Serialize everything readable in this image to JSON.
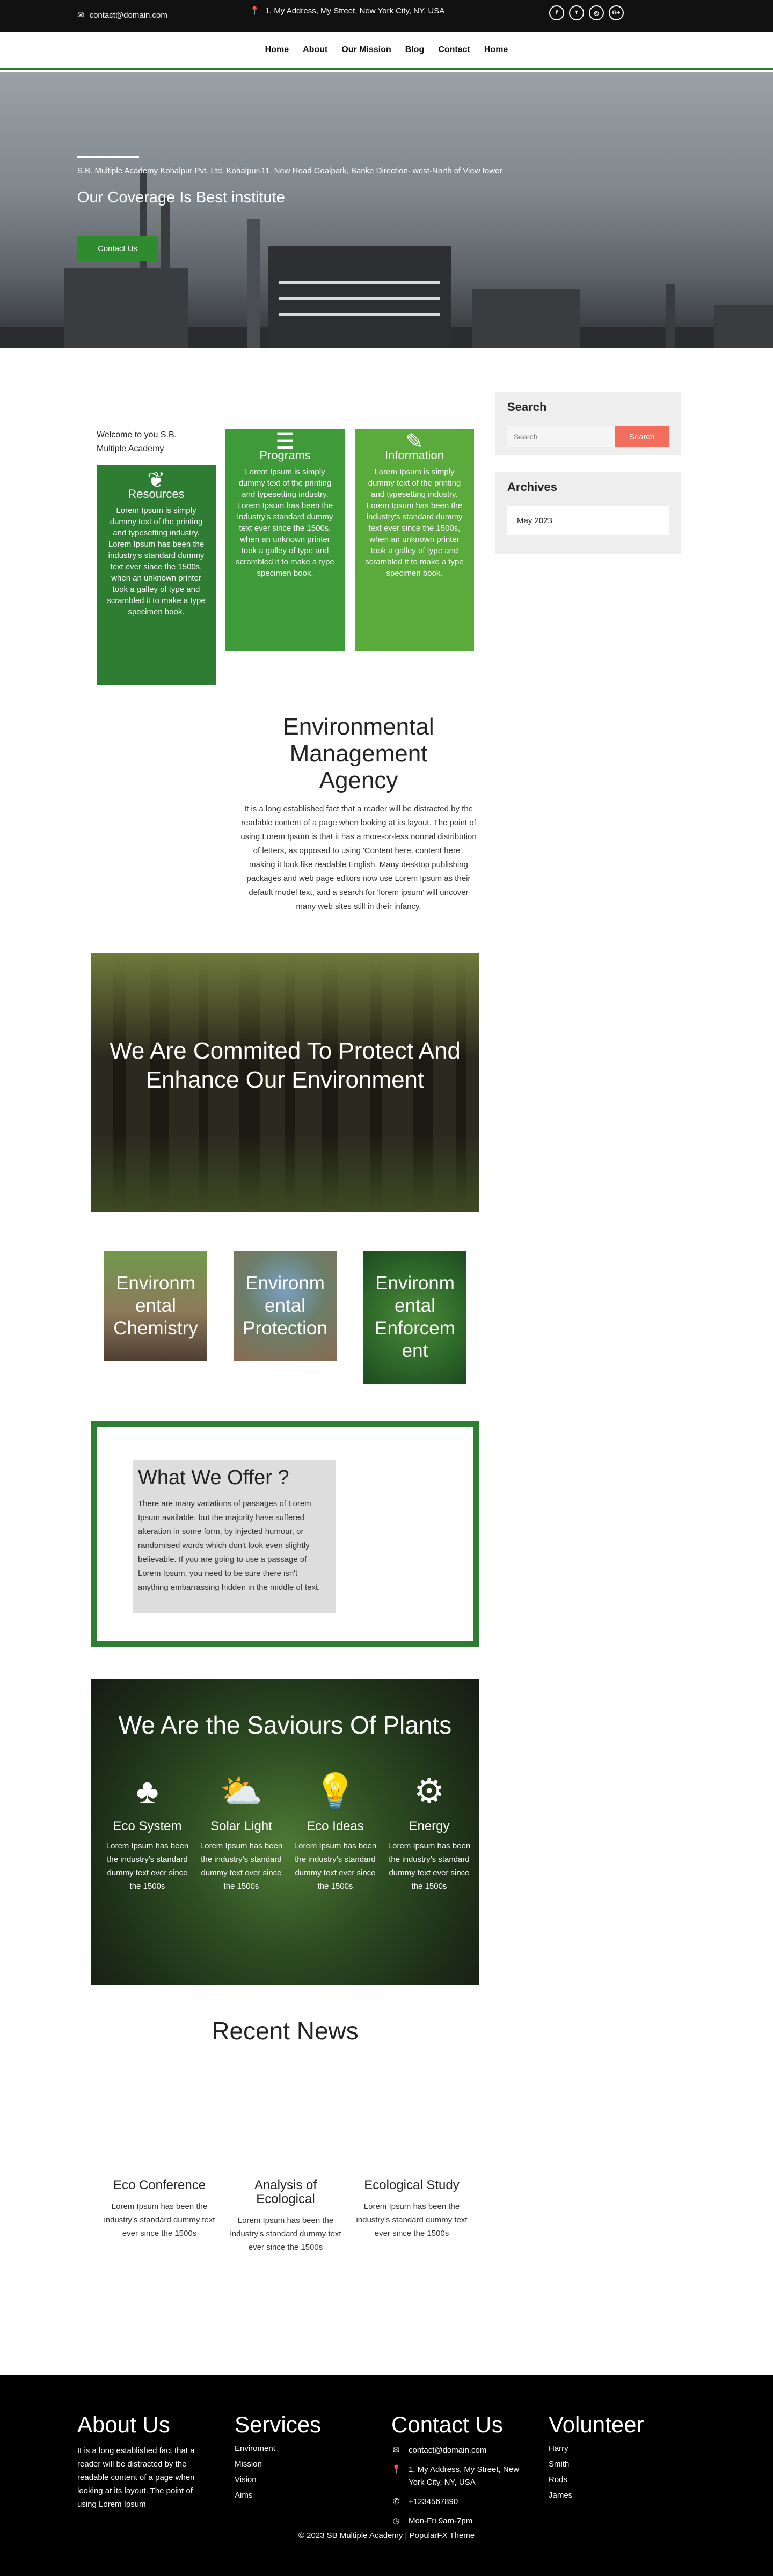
{
  "topbar": {
    "email": "contact@domain.com",
    "address": "1, My Address, My Street, New York City, NY, USA",
    "social": [
      "facebook-icon",
      "twitter-icon",
      "instagram-icon",
      "google-plus-icon"
    ]
  },
  "nav": {
    "items": [
      "Home",
      "About",
      "Our Mission",
      "Blog",
      "Contact",
      "Home"
    ]
  },
  "hero": {
    "address": "S.B. Multiple Academy Kohalpur Pvt. Ltd, Kohalpur-11, New Road Goalpark, Banke Direction- west-North of View tower",
    "title": "Our Coverage Is Best institute",
    "button": "Contact Us"
  },
  "sidebar": {
    "search_title": "Search",
    "search_placeholder": "Search",
    "search_button": "Search",
    "archives_title": "Archives",
    "archive_item": "May 2023"
  },
  "welcome": "Welcome to you S.B. Multiple Academy",
  "cards": [
    {
      "title": "Resources",
      "icon": "leaf-icon",
      "text": "Lorem Ipsum is simply dummy text of the printing and typesetting industry. Lorem Ipsum has been the industry's standard dummy text ever since the 1500s, when an unknown printer took a galley of type and scrambled it to make a type specimen book."
    },
    {
      "title": "Programs",
      "icon": "list-icon",
      "text": "Lorem Ipsum is simply dummy text of the printing and typesetting industry. Lorem Ipsum has been the industry's standard dummy text ever since the 1500s, when an unknown printer took a galley of type and scrambled it to make a type specimen book."
    },
    {
      "title": "Information",
      "icon": "edit-icon",
      "text": "Lorem Ipsum is simply dummy text of the printing and typesetting industry. Lorem Ipsum has been the industry's standard dummy text ever since the 1500s, when an unknown printer took a galley of type and scrambled it to make a type specimen book."
    }
  ],
  "environment": {
    "title": "Environmental Management Agency",
    "text": "It is a long established fact that a reader will be distracted by the readable content of a page when looking at its layout. The point of using Lorem Ipsum is that it has a more-or-less normal distribution of letters, as opposed to using 'Content here, content here', making it look like readable English. Many desktop publishing packages and web page editors now use Lorem Ipsum as their default model text, and a search for 'lorem ipsum' will uncover many web sites still in their infancy."
  },
  "commit": {
    "title": "We Are Commited To Protect And Enhance Our Environment"
  },
  "tiles": [
    "Environmental Chemistry",
    "Environmental Protection",
    "Environmental Enforcement"
  ],
  "tile_lines": [
    [
      "Environm",
      "ental",
      "Chemistry"
    ],
    [
      "Environm",
      "ental",
      "Protection"
    ],
    [
      "Environm",
      "ental",
      "Enforcem",
      "ent"
    ]
  ],
  "offer": {
    "title": "What We Offer ?",
    "text": "There are many variations of passages of Lorem Ipsum available, but the majority have suffered alteration in some form, by injected humour, or randomised words which don't look even slightly believable. If you are going to use a passage of Lorem Ipsum, you need to be sure there isn't anything embarrassing hidden in the middle of text."
  },
  "plants": {
    "title": "We Are the Saviours Of Plants",
    "items": [
      {
        "title": "Eco System",
        "icon": "tree-icon",
        "text": "Lorem Ipsum has been the industry's standard dummy text ever since the 1500s"
      },
      {
        "title": "Solar Light",
        "icon": "sun-cloud-icon",
        "text": "Lorem Ipsum has been the industry's standard dummy text ever since the 1500s"
      },
      {
        "title": "Eco Ideas",
        "icon": "lightbulb-icon",
        "text": "Lorem Ipsum has been the industry's standard dummy text ever since the 1500s"
      },
      {
        "title": "Energy",
        "icon": "gear-icon",
        "text": "Lorem Ipsum has been the industry's standard dummy text ever since the 1500s"
      }
    ]
  },
  "news": {
    "title": "Recent News",
    "items": [
      {
        "title": "Eco Conference",
        "text": "Lorem Ipsum has been the industry's standard dummy text ever since the 1500s"
      },
      {
        "title": "Analysis of Ecological",
        "text": "Lorem Ipsum has been the industry's standard dummy text ever since the 1500s"
      },
      {
        "title": "Ecological Study",
        "text": "Lorem Ipsum has been the industry's standard dummy text ever since the 1500s"
      }
    ]
  },
  "footer": {
    "about_title": "About Us",
    "about_text": "It is a long established fact that a reader will be distracted by the readable content of a page when looking at its layout. The point of using Lorem Ipsum",
    "services_title": "Services",
    "services": [
      "Enviroment",
      "Mission",
      "Vision",
      "Aims"
    ],
    "contact_title": "Contact Us",
    "contact_email": "contact@domain.com",
    "contact_address": "1, My Address, My Street, New York City, NY, USA",
    "contact_phone": "+1234567890",
    "contact_hours": "Mon-Fri 9am-7pm",
    "volunteer_title": "Volunteer",
    "volunteers": [
      "Harry",
      "Smith",
      "Rods",
      "James"
    ],
    "copyright": "© 2023 SB Multiple Academy | PopularFX Theme"
  },
  "colors": {
    "accent": "#2e7d32",
    "card_dark": "#2e7d32",
    "card_mid": "#3f9a3a",
    "card_light": "#5aaa3c",
    "search_button": "#f26d5b",
    "footer": "#000000"
  }
}
